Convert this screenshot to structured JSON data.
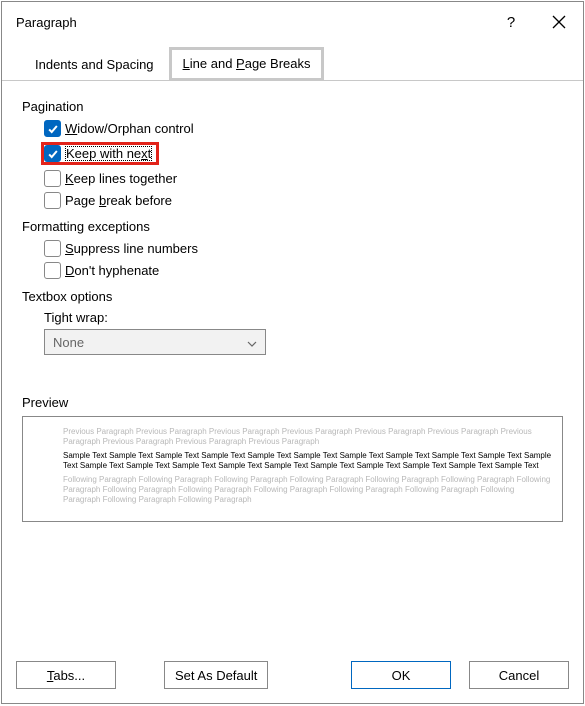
{
  "title": "Paragraph",
  "help_symbol": "?",
  "tabs": {
    "indents": "Indents and Spacing",
    "breaks": "Line and Page Breaks"
  },
  "pagination": {
    "label": "Pagination",
    "widow": "Widow/Orphan control",
    "keep_next": "Keep with next",
    "keep_lines": "Keep lines together",
    "page_break": "Page break before"
  },
  "formatting": {
    "label": "Formatting exceptions",
    "suppress": "Suppress line numbers",
    "hyphen": "Don't hyphenate"
  },
  "textbox": {
    "label": "Textbox options",
    "tight_label": "Tight wrap:",
    "value": "None"
  },
  "preview": {
    "label": "Preview",
    "prev": "Previous Paragraph Previous Paragraph Previous Paragraph Previous Paragraph Previous Paragraph Previous Paragraph Previous Paragraph Previous Paragraph Previous Paragraph Previous Paragraph",
    "sample": "Sample Text Sample Text Sample Text Sample Text Sample Text Sample Text Sample Text Sample Text Sample Text Sample Text Sample Text Sample Text Sample Text Sample Text Sample Text Sample Text Sample Text Sample Text Sample Text Sample Text Sample Text",
    "next": "Following Paragraph Following Paragraph Following Paragraph Following Paragraph Following Paragraph Following Paragraph Following Paragraph Following Paragraph Following Paragraph Following Paragraph Following Paragraph Following Paragraph Following Paragraph Following Paragraph Following Paragraph"
  },
  "buttons": {
    "tabs": "Tabs...",
    "default": "Set As Default",
    "ok": "OK",
    "cancel": "Cancel"
  }
}
